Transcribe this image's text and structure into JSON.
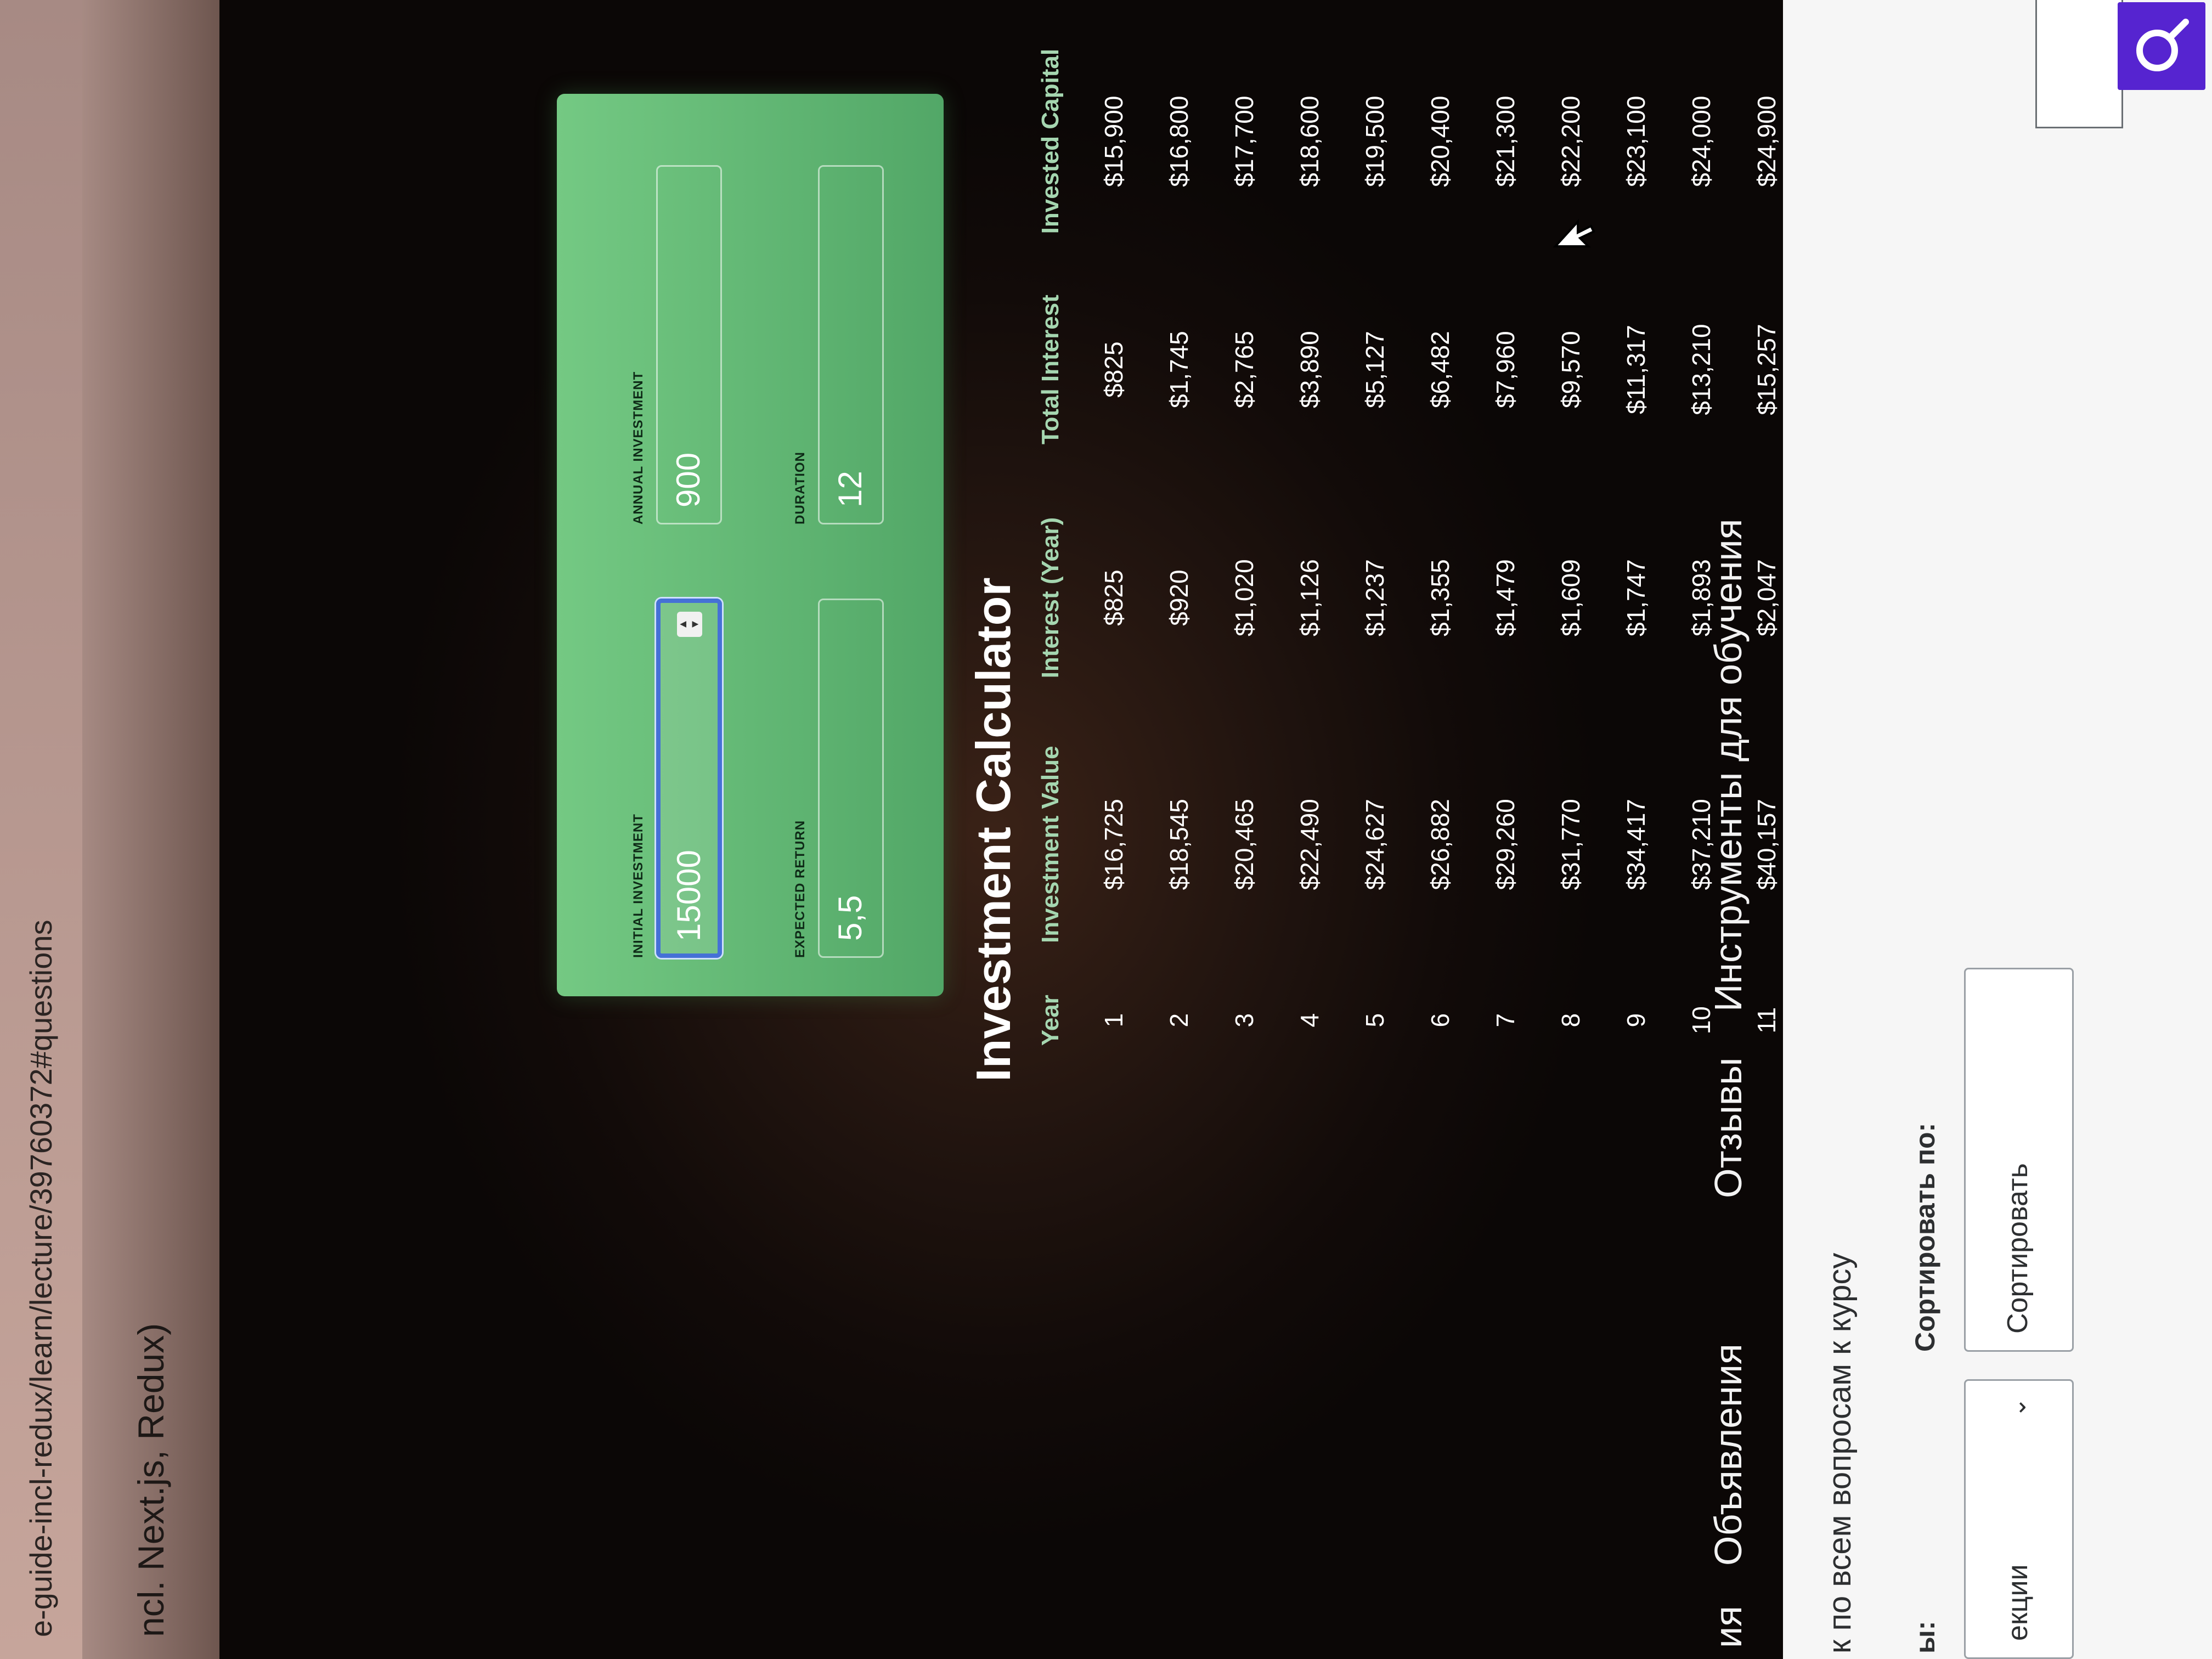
{
  "browser": {
    "url": "e-guide-incl-redux/learn/lecture/39760372#questions"
  },
  "course": {
    "title": "ncl. Next.js, Redux)"
  },
  "app": {
    "title": "Investment Calculator",
    "logo_icon": "money-bag-icon"
  },
  "form": {
    "initial_investment": {
      "label": "INITIAL INVESTMENT",
      "value": "15000"
    },
    "annual_investment": {
      "label": "ANNUAL INVESTMENT",
      "value": "900"
    },
    "expected_return": {
      "label": "EXPECTED RETURN",
      "value": "5,5"
    },
    "duration": {
      "label": "DURATION",
      "value": "12"
    }
  },
  "results": {
    "headers": [
      "Year",
      "Investment Value",
      "Interest (Year)",
      "Total Interest",
      "Invested Capital"
    ],
    "rows": [
      [
        "1",
        "$16,725",
        "$825",
        "$825",
        "$15,900"
      ],
      [
        "2",
        "$18,545",
        "$920",
        "$1,745",
        "$16,800"
      ],
      [
        "3",
        "$20,465",
        "$1,020",
        "$2,765",
        "$17,700"
      ],
      [
        "4",
        "$22,490",
        "$1,126",
        "$3,890",
        "$18,600"
      ],
      [
        "5",
        "$24,627",
        "$1,237",
        "$5,127",
        "$19,500"
      ],
      [
        "6",
        "$26,882",
        "$1,355",
        "$6,482",
        "$20,400"
      ],
      [
        "7",
        "$29,260",
        "$1,479",
        "$7,960",
        "$21,300"
      ],
      [
        "8",
        "$31,770",
        "$1,609",
        "$9,570",
        "$22,200"
      ],
      [
        "9",
        "$34,417",
        "$1,747",
        "$11,317",
        "$23,100"
      ],
      [
        "10",
        "$37,210",
        "$1,893",
        "$13,210",
        "$24,000"
      ],
      [
        "11",
        "$40,157",
        "$2,047",
        "$15,257",
        "$24,900"
      ]
    ]
  },
  "course_tabs": [
    "ия",
    "Объявления",
    "Отзывы",
    "Инструменты для обучения"
  ],
  "qa": {
    "back_link": "к по всем вопросам к курсу",
    "filter_label": "ы:",
    "sort_label": "Сортировать по:",
    "filter_value": "екции",
    "sort_value": "Сортировать",
    "search_icon": "search-icon"
  },
  "colors": {
    "panel_green": "#5db870",
    "header_green": "#a5d6b0",
    "focus_blue": "#4571d6",
    "search_purple": "#5624d0"
  }
}
